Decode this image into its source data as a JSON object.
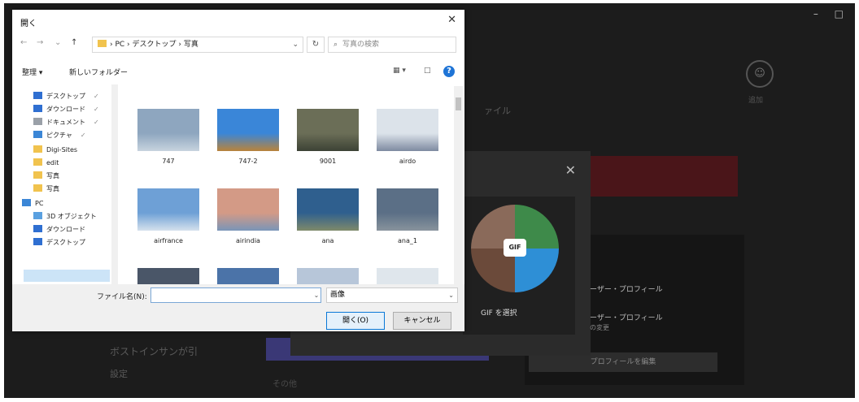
{
  "background": {
    "window_controls": "– □",
    "circle_icon": "☺",
    "circle_label": "追加",
    "text1": "ァイル",
    "text2": "ボストインサンが引",
    "text3": "設定",
    "text4": "その他",
    "sidepanel_btn": "プロフィールを編集"
  },
  "modal": {
    "close": "✕",
    "gif_badge": "GIF",
    "gif_label": "GIF を選択",
    "side_text1": "ーザー・プロフィール",
    "side_text2": "ーザー・プロフィール",
    "side_text3": "の変更"
  },
  "dialog": {
    "title": "開く",
    "close": "✕",
    "nav": {
      "back": "←",
      "forward": "→",
      "dropdown": "⌄",
      "up": "↑"
    },
    "address": "› PC › デスクトップ › 写真",
    "address_dropdown": "⌄",
    "refresh": "↻",
    "search_placeholder": "写真の検索",
    "toolbar": {
      "organize": "整理 ▾",
      "new_folder": "新しいフォルダー",
      "view": "▦ ▾",
      "preview": "□"
    },
    "help": "?",
    "sidebar": [
      {
        "label": "デスクトップ",
        "pin": "✓",
        "icon": "#2f6fd1"
      },
      {
        "label": "ダウンロード",
        "pin": "✓",
        "icon": "#2f6fd1"
      },
      {
        "label": "ドキュメント",
        "pin": "✓",
        "icon": "#9aa0a8"
      },
      {
        "label": "ピクチャ",
        "pin": "✓",
        "icon": "#3b86d6"
      },
      {
        "label": "Digi-Sites",
        "pin": "",
        "icon": "#f1c34e"
      },
      {
        "label": "edit",
        "pin": "",
        "icon": "#f1c34e"
      },
      {
        "label": "写真",
        "pin": "",
        "icon": "#f1c34e"
      },
      {
        "label": "写真",
        "pin": "",
        "icon": "#f1c34e"
      },
      {
        "label": "PC",
        "pin": "",
        "icon": "#3b86d6"
      },
      {
        "label": "3D オブジェクト",
        "pin": "",
        "icon": "#5aa0e0"
      },
      {
        "label": "ダウンロード",
        "pin": "",
        "icon": "#2f6fd1"
      },
      {
        "label": "デスクトップ",
        "pin": "",
        "icon": "#2f6fd1"
      }
    ],
    "files": [
      {
        "name": "747",
        "c1": "#8ea6bf",
        "c2": "#c7d3de"
      },
      {
        "name": "747-2",
        "c1": "#3a86d8",
        "c2": "#b9833a"
      },
      {
        "name": "9001",
        "c1": "#6b6e57",
        "c2": "#3c4235"
      },
      {
        "name": "airdo",
        "c1": "#dce3ea",
        "c2": "#7e8aa0"
      },
      {
        "name": "airfrance",
        "c1": "#6ea0d6",
        "c2": "#d5e1ec"
      },
      {
        "name": "airindia",
        "c1": "#d39a86",
        "c2": "#7a95b8"
      },
      {
        "name": "ana",
        "c1": "#2f5f8e",
        "c2": "#7f8a6a"
      },
      {
        "name": "ana_1",
        "c1": "#5b6f86",
        "c2": "#88939c"
      },
      {
        "name": "",
        "c1": "#4a5668",
        "c2": "#6d7888"
      },
      {
        "name": "",
        "c1": "#4b73a8",
        "c2": "#9ab1cc"
      },
      {
        "name": "",
        "c1": "#b7c6d9",
        "c2": "#e1e8f0"
      },
      {
        "name": "",
        "c1": "#dfe6ec",
        "c2": "#eef2f5"
      }
    ],
    "filename_label": "ファイル名(N):",
    "filename_value": "",
    "filetype_value": "画像",
    "open_label": "開く(O)",
    "cancel_label": "キャンセル"
  }
}
